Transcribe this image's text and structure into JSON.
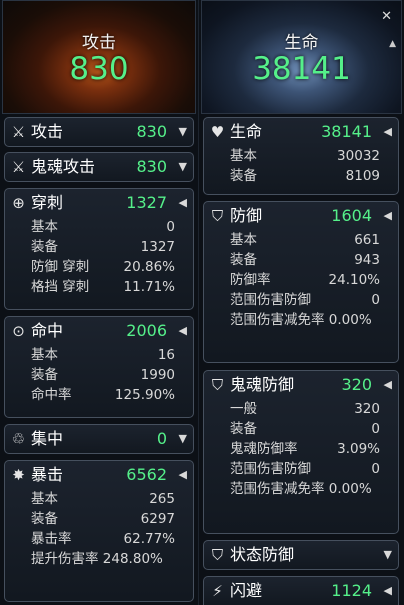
{
  "left": {
    "hero": {
      "title": "攻击",
      "value": "830"
    },
    "panels": {
      "attack": {
        "name": "攻击",
        "value": "830"
      },
      "ghost_attack": {
        "name": "鬼魂攻击",
        "value": "830"
      },
      "pierce": {
        "name": "穿刺",
        "value": "1327",
        "rows": [
          {
            "label": "基本",
            "value": "0"
          },
          {
            "label": "装备",
            "value": "1327"
          },
          {
            "label": "防御 穿刺",
            "value": "20.86%"
          },
          {
            "label": "格挡 穿刺",
            "value": "11.71%"
          }
        ]
      },
      "accuracy": {
        "name": "命中",
        "value": "2006",
        "rows": [
          {
            "label": "基本",
            "value": "16"
          },
          {
            "label": "装备",
            "value": "1990"
          },
          {
            "label": "命中率",
            "value": "125.90%"
          }
        ]
      },
      "focus": {
        "name": "集中",
        "value": "0"
      },
      "crit": {
        "name": "暴击",
        "value": "6562",
        "rows": [
          {
            "label": "基本",
            "value": "265"
          },
          {
            "label": "装备",
            "value": "6297"
          },
          {
            "label": "暴击率",
            "value": "62.77%"
          }
        ],
        "wrap_row": "提升伤害率 248.80%"
      }
    }
  },
  "right": {
    "hero": {
      "title": "生命",
      "value": "38141",
      "close": "✕"
    },
    "panels": {
      "hp": {
        "name": "生命",
        "value": "38141",
        "rows": [
          {
            "label": "基本",
            "value": "30032"
          },
          {
            "label": "装备",
            "value": "8109"
          }
        ]
      },
      "defense": {
        "name": "防御",
        "value": "1604",
        "rows": [
          {
            "label": "基本",
            "value": "661"
          },
          {
            "label": "装备",
            "value": "943"
          },
          {
            "label": "防御率",
            "value": "24.10%"
          },
          {
            "label": "范围伤害防御",
            "value": "0"
          }
        ],
        "wrap_row": "范围伤害减免率 0.00%"
      },
      "ghost_defense": {
        "name": "鬼魂防御",
        "value": "320",
        "rows": [
          {
            "label": "一般",
            "value": "320"
          },
          {
            "label": "装备",
            "value": "0"
          },
          {
            "label": "鬼魂防御率",
            "value": "3.09%"
          },
          {
            "label": "范围伤害防御",
            "value": "0"
          }
        ],
        "wrap_row": "范围伤害减免率 0.00%"
      },
      "status_defense": {
        "name": "状态防御"
      },
      "evasion": {
        "name": "闪避",
        "value": "1124"
      }
    }
  },
  "icons": {
    "attack": "crossed-swords-icon",
    "ghost_attack": "ghost-sword-icon",
    "pierce": "pierce-arrow-icon",
    "accuracy": "crosshair-icon",
    "focus": "triple-circle-icon",
    "crit": "starburst-icon",
    "hp": "heart-icon",
    "defense": "shield-icon",
    "ghost_defense": "ghost-shield-icon",
    "status_defense": "status-shield-icon",
    "evasion": "lightning-icon"
  },
  "colors": {
    "value_green": "#55f08a",
    "panel_border": "#46505e",
    "background": "#0c1016"
  }
}
